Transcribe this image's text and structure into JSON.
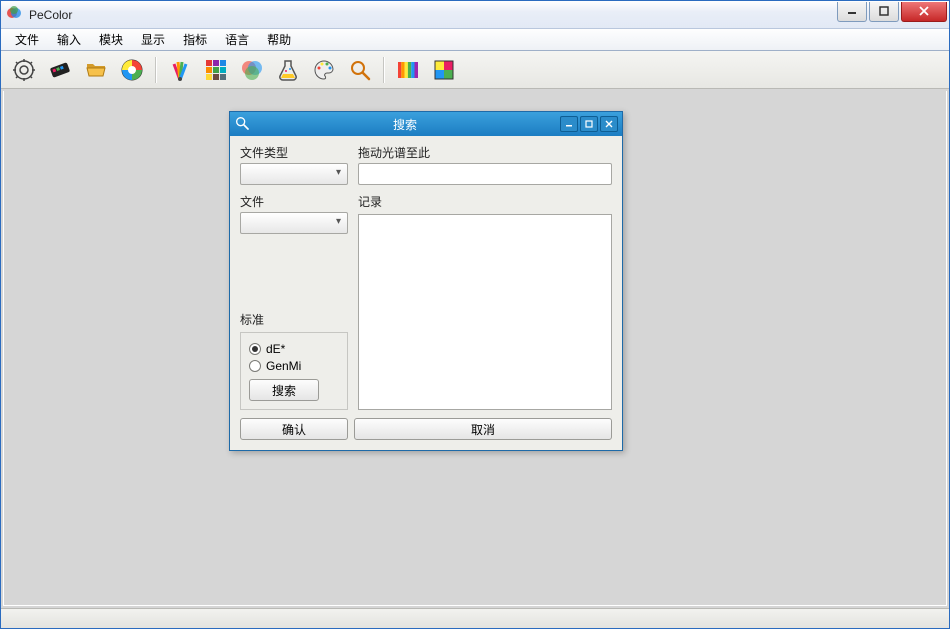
{
  "window": {
    "title": "PeColor"
  },
  "menu": {
    "file": "文件",
    "input": "输入",
    "module": "模块",
    "display": "显示",
    "indicator": "指标",
    "language": "语言",
    "help": "帮助"
  },
  "toolbar": {
    "icons": [
      "settings-gear-icon",
      "color-chip-icon",
      "folder-open-icon",
      "color-wheel-icon",
      "fan-deck-icon",
      "swatch-grid-icon",
      "venn-icon",
      "flask-icon",
      "palette-icon",
      "search-icon",
      "spectrum-icon",
      "color-block-icon"
    ]
  },
  "dialog": {
    "title": "搜索",
    "fileTypeLabel": "文件类型",
    "fileLabel": "文件",
    "standardLabel": "标准",
    "radio1": "dE*",
    "radio2": "GenMi",
    "searchBtn": "搜索",
    "dragLabel": "拖动光谱至此",
    "recordLabel": "记录",
    "okBtn": "确认",
    "cancelBtn": "取消",
    "fileTypeValue": "",
    "fileValue": "",
    "dragValue": "",
    "recordValue": ""
  }
}
